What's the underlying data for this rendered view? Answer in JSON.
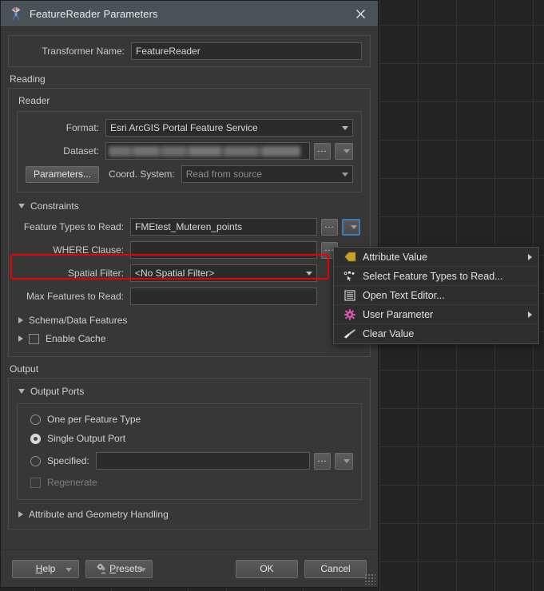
{
  "window": {
    "title": "FeatureReader Parameters",
    "icon": "featurereader-icon",
    "close_label": "×"
  },
  "transformer": {
    "name_label": "Transformer Name:",
    "name_value": "FeatureReader"
  },
  "reading": {
    "section_label": "Reading",
    "reader": {
      "group_label": "Reader",
      "format_label": "Format:",
      "format_value": "Esri ArcGIS Portal Feature Service",
      "dataset_label": "Dataset:",
      "dataset_value": "",
      "dataset_redacted": true,
      "parameters_button": "Parameters...",
      "coord_system_label": "Coord. System:",
      "coord_system_value": "Read from source"
    },
    "constraints": {
      "group_label": "Constraints",
      "expanded": true,
      "feature_types_label": "Feature Types to Read:",
      "feature_types_value": "FMEtest_Muteren_points",
      "where_clause_label": "WHERE Clause:",
      "where_clause_value": "",
      "spatial_filter_label": "Spatial Filter:",
      "spatial_filter_value": "<No Spatial Filter>",
      "max_features_label": "Max Features to Read:",
      "max_features_value": "",
      "highlight_color": "#ee0000",
      "focus_color": "#3d7eb8"
    },
    "schema_data_features_label": "Schema/Data Features",
    "enable_cache_label": "Enable Cache",
    "enable_cache_checked": false
  },
  "output": {
    "section_label": "Output",
    "ports": {
      "group_label": "Output Ports",
      "expanded": true,
      "options": [
        {
          "label": "One per Feature Type",
          "selected": false
        },
        {
          "label": "Single Output Port",
          "selected": true
        },
        {
          "label": "Specified:",
          "selected": false
        }
      ],
      "specified_value": "",
      "regenerate_label": "Regenerate",
      "regenerate_checked": false,
      "regenerate_disabled": true
    },
    "attribute_geometry_label": "Attribute and Geometry Handling"
  },
  "footer": {
    "help_label": "Help",
    "help_mnemonic": "H",
    "presets_label": "Presets",
    "presets_mnemonic": "P",
    "ok_label": "OK",
    "cancel_label": "Cancel"
  },
  "context_menu": {
    "items": [
      {
        "label": "Attribute Value",
        "icon": "attribute-value-icon",
        "submenu": true,
        "icon_color": "#c9a227"
      },
      {
        "label": "Select Feature Types to Read...",
        "icon": "select-feature-types-icon",
        "submenu": false,
        "icon_color": "#e0e0e0"
      },
      {
        "label": "Open Text Editor...",
        "icon": "text-editor-icon",
        "submenu": false,
        "icon_color": "#dcdcdc"
      },
      {
        "label": "User Parameter",
        "icon": "gear-icon",
        "submenu": true,
        "icon_color": "#e154b5"
      },
      {
        "label": "Clear Value",
        "icon": "clear-value-icon",
        "submenu": false,
        "icon_color": "#d7d7d7"
      }
    ]
  }
}
